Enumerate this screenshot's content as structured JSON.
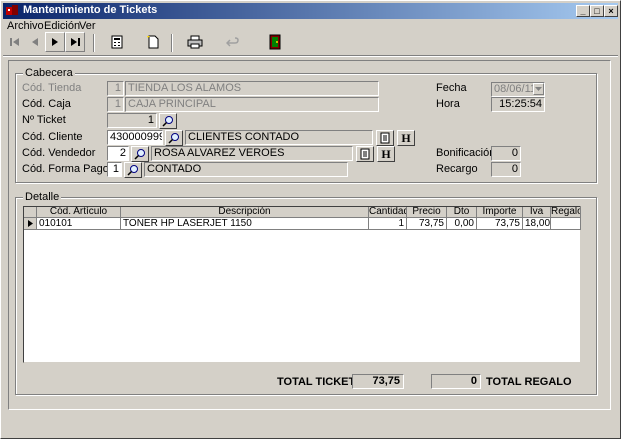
{
  "window": {
    "title": "Mantenimiento de Tickets"
  },
  "menu": {
    "archivo": "Archivo",
    "edicion": "Edición",
    "ver": "Ver"
  },
  "cabecera": {
    "title": "Cabecera",
    "tienda": {
      "label": "Cód. Tienda",
      "code": "1",
      "name": "TIENDA LOS ALAMOS"
    },
    "caja": {
      "label": "Cód. Caja",
      "code": "1",
      "name": "CAJA PRINCIPAL"
    },
    "ticket": {
      "label": "Nº Ticket",
      "value": "1"
    },
    "cliente": {
      "label": "Cód. Cliente",
      "code": "4300009999",
      "name": "CLIENTES CONTADO"
    },
    "vendedor": {
      "label": "Cód. Vendedor",
      "code": "2",
      "name": "ROSA ALVAREZ VEROES"
    },
    "forma_pago": {
      "label": "Cód. Forma Pago",
      "code": "1",
      "name": "CONTADO"
    },
    "fecha": {
      "label": "Fecha",
      "value": "08/06/11"
    },
    "hora": {
      "label": "Hora",
      "value": "15:25:54"
    },
    "bonificacion": {
      "label": "Bonificación",
      "value": "0"
    },
    "recargo": {
      "label": "Recargo",
      "value": "0"
    },
    "h_button": "H"
  },
  "detalle": {
    "title": "Detalle",
    "columns": [
      "Cód. Artículo",
      "Descripción",
      "Cantidad",
      "Precio",
      "Dto",
      "Importe",
      "Iva",
      "Regalo"
    ],
    "rows": [
      {
        "codigo": "010101",
        "descripcion": "TONER HP LASERJET 1150",
        "cantidad": "1",
        "precio": "73,75",
        "dto": "0,00",
        "importe": "73,75",
        "iva": "18,00",
        "regalo": ""
      }
    ]
  },
  "totals": {
    "ticket_label": "TOTAL TICKET",
    "ticket_value": "73,75",
    "regalo_label": "TOTAL REGALO",
    "regalo_value": "0"
  },
  "icons": {
    "first": "first-record-icon",
    "prev": "previous-record-icon",
    "next": "next-record-icon",
    "last": "last-record-icon",
    "calc": "calculator-icon",
    "new": "new-document-icon",
    "print": "printer-icon",
    "undo": "undo-icon",
    "exit": "exit-door-icon"
  },
  "colors": {
    "titlebar_start": "#0a246a",
    "titlebar_end": "#a6caf0",
    "face": "#d4d0c8"
  }
}
